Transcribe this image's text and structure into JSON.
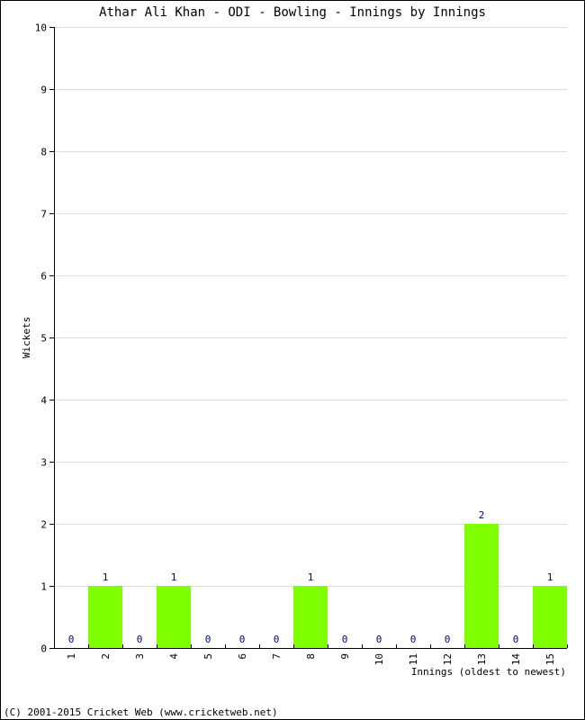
{
  "chart_data": {
    "type": "bar",
    "title": "Athar Ali Khan - ODI - Bowling - Innings by Innings",
    "xlabel": "Innings (oldest to newest)",
    "ylabel": "Wickets",
    "categories": [
      "1",
      "2",
      "3",
      "4",
      "5",
      "6",
      "7",
      "8",
      "9",
      "10",
      "11",
      "12",
      "13",
      "14",
      "15"
    ],
    "values": [
      0,
      1,
      0,
      1,
      0,
      0,
      0,
      1,
      0,
      0,
      0,
      0,
      2,
      0,
      1
    ],
    "ylim": [
      0,
      10
    ],
    "yticks": [
      "0",
      "1",
      "2",
      "3",
      "4",
      "5",
      "6",
      "7",
      "8",
      "9",
      "10"
    ],
    "grid": true,
    "bar_color": "#80ff00",
    "label_color": "#000080"
  },
  "footer": {
    "copyright": "(C) 2001-2015 Cricket Web (www.cricketweb.net)"
  }
}
